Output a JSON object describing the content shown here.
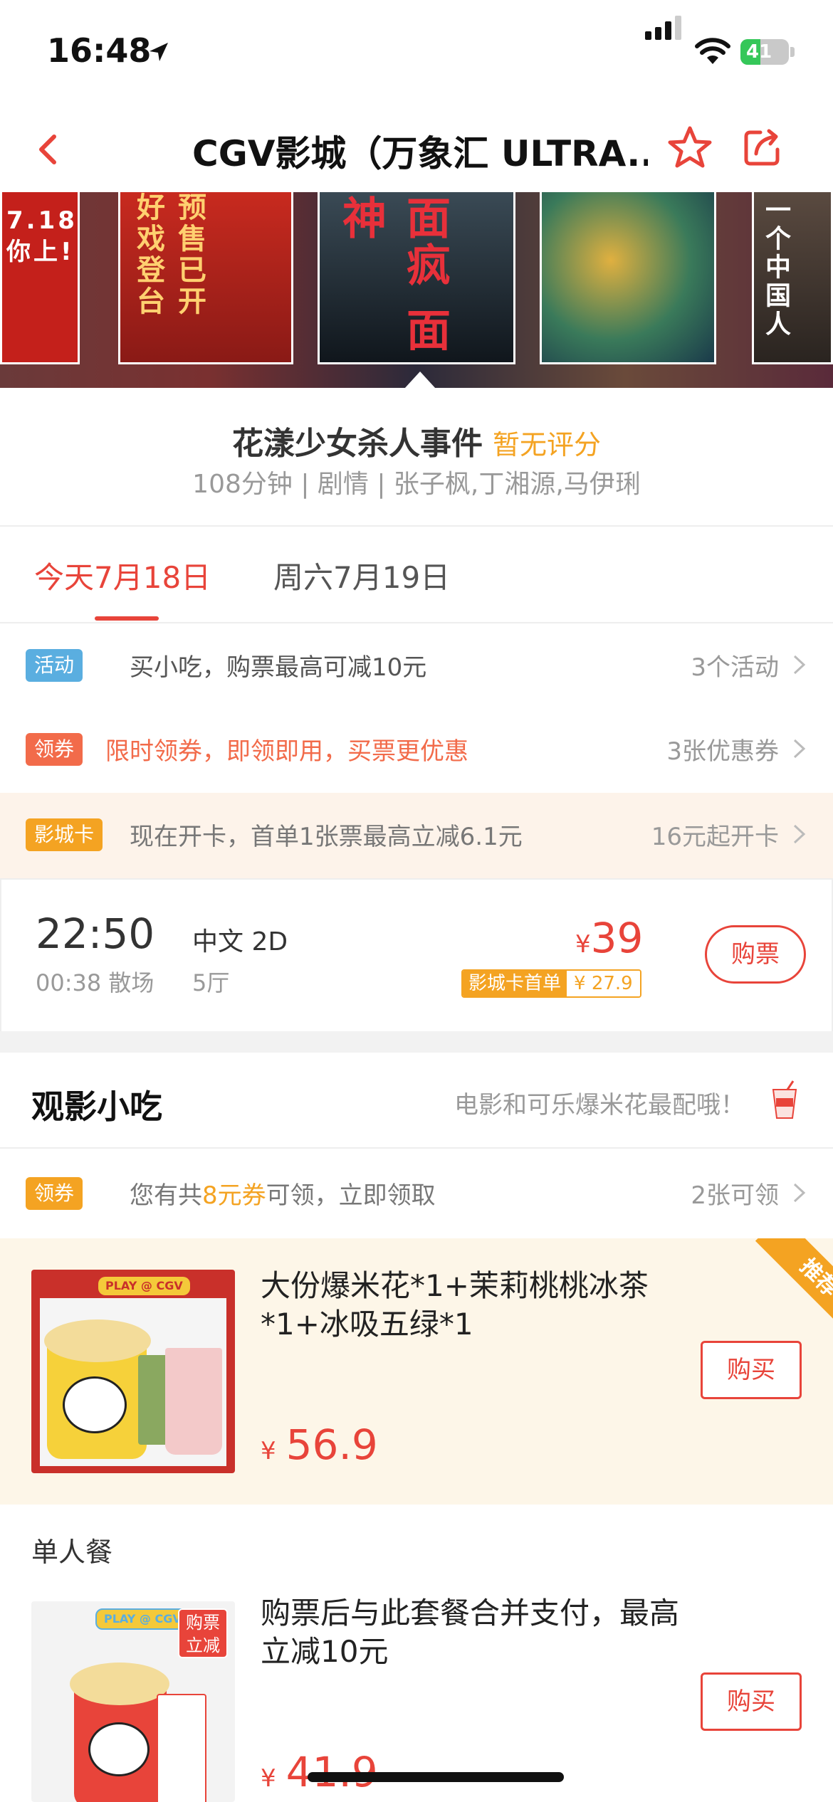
{
  "status_bar": {
    "time": "16:48",
    "battery": "41",
    "battery_level": 0.41
  },
  "nav": {
    "title": "CGV影城（万象汇 ULTRA..."
  },
  "posters": [
    {
      "text": "7.18 你上!"
    },
    {
      "text": "预售已开 好戏登台"
    },
    {
      "text": "面疯 面神"
    },
    {
      "text": ""
    },
    {
      "text": "一个中国人"
    }
  ],
  "movie": {
    "title": "花漾少女杀人事件",
    "rating": "暂无评分",
    "meta": "108分钟 | 剧情 | 张子枫,丁湘源,马伊琍"
  },
  "dates": {
    "active": "今天7月18日",
    "inactive": "周六7月19日"
  },
  "promos": [
    {
      "badge": "活动",
      "text": "买小吃，购票最高可减10元",
      "right": "3个活动"
    },
    {
      "badge": "领券",
      "text": "限时领券，即领即用，买票更优惠",
      "right": "3张优惠券"
    },
    {
      "badge": "影城卡",
      "text": "现在开卡，首单1张票最高立减6.1元",
      "right": "16元起开卡"
    }
  ],
  "showtime": {
    "start": "22:50",
    "end": "00:38 散场",
    "lang": "中文 2D",
    "hall": "5厅",
    "currency": "¥",
    "price": "39",
    "card_label": "影城卡首单",
    "card_price": "¥ 27.9",
    "buy": "购票"
  },
  "snacks": {
    "title": "观影小吃",
    "slogan": "电影和可乐爆米花最配哦！",
    "coupon_badge": "领券",
    "coupon_prefix": "您有共",
    "coupon_amount": "8元券",
    "coupon_suffix": "可领，立即领取",
    "coupon_right": "2张可领"
  },
  "food": [
    {
      "name": "大份爆米花*1+茉莉桃桃冰茶*1+冰吸五绿*1",
      "currency": "¥",
      "price": "56.9",
      "buy": "购买",
      "ribbon": "推荐",
      "img_label": "PLAY @ CGV"
    },
    {
      "name": "购票后与此套餐合并支付，最高立减10元",
      "currency": "¥",
      "price": "41.9",
      "buy": "购买",
      "img_label": "PLAY @ CGV",
      "img_badge": "购票立减"
    }
  ],
  "section": {
    "single_meal": "单人餐"
  },
  "colors": {
    "accent": "#e8443a",
    "orange": "#f4a322",
    "blue_badge": "#5aaee0",
    "coupon_badge": "#f26b4a"
  }
}
